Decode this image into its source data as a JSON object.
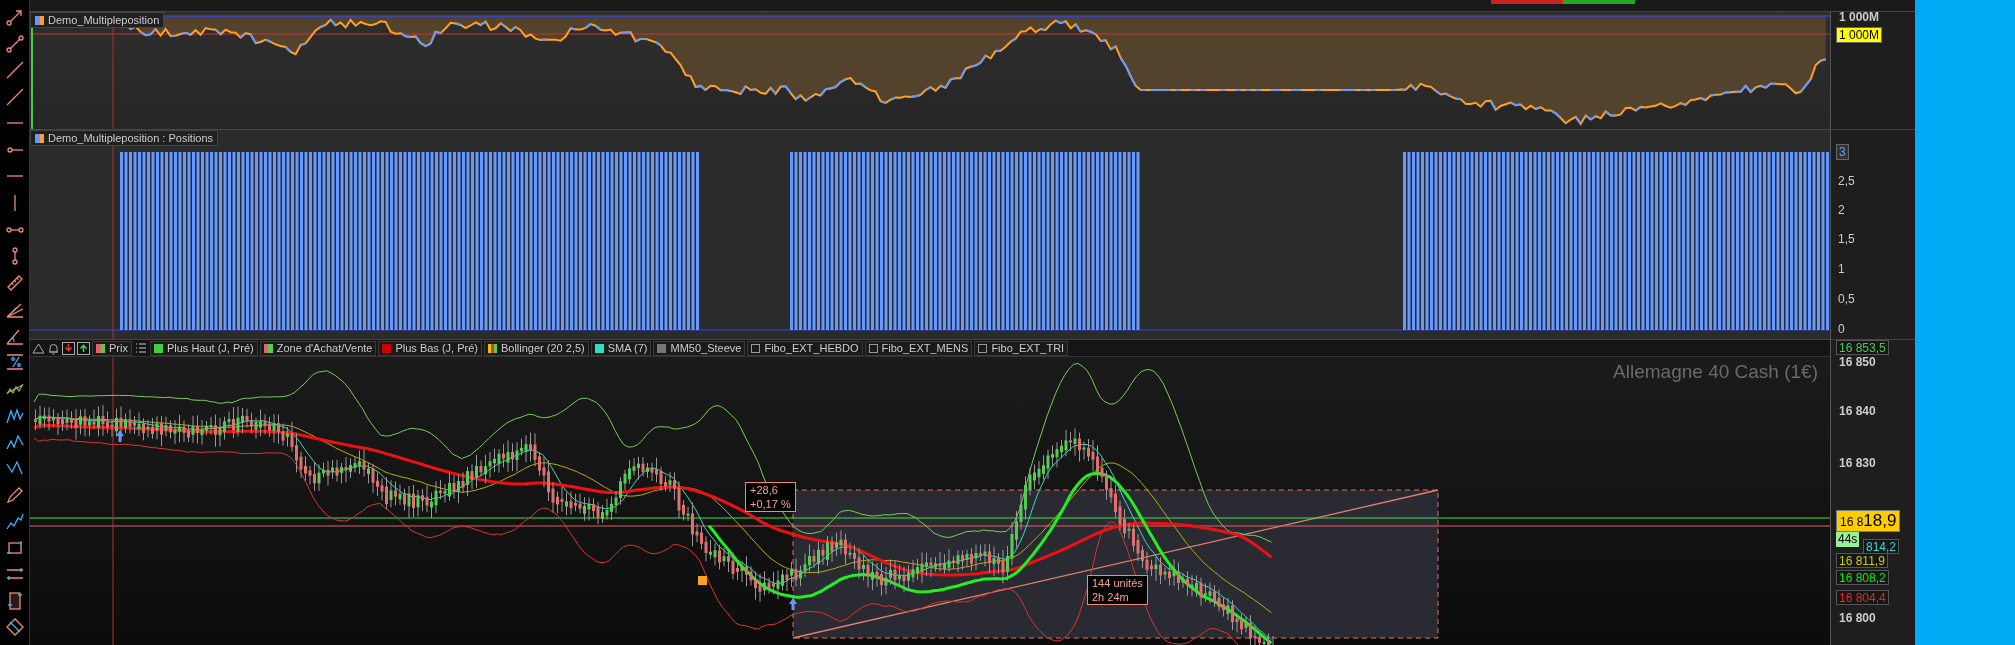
{
  "equity_panel": {
    "title": "Demo_Multipleposition",
    "axis_labels": [
      "1 000M"
    ],
    "current_value": "1 000M"
  },
  "positions_panel": {
    "title": "Demo_Multipleposition : Positions",
    "current_value": "3",
    "axis_labels": [
      "2,5",
      "2",
      "1,5",
      "1",
      "0,5",
      "0"
    ]
  },
  "price_panel": {
    "instrument": "Allemagne 40 Cash (1€)",
    "legend": [
      {
        "kind": "swatch",
        "label": "Prix",
        "swatch": [
          {
            "color": "#e06666"
          },
          {
            "color": "#55cc55"
          }
        ]
      },
      {
        "kind": "list-button"
      },
      {
        "kind": "swatch",
        "label": "Plus Haut (J, Pré)",
        "swatch": [
          {
            "color": "#44cc44"
          }
        ]
      },
      {
        "kind": "swatch",
        "label": "Zone d'Achat/Vente",
        "swatch": [
          {
            "color": "#e06666"
          },
          {
            "color": "#55cc55"
          }
        ]
      },
      {
        "kind": "swatch",
        "label": "Plus Bas (J, Pré)",
        "swatch": [
          {
            "color": "#cc0000"
          }
        ]
      },
      {
        "kind": "swatch",
        "label": "Bollinger (20 2,5)",
        "swatch": [
          {
            "color": "#e0c000"
          },
          {
            "color": "#dd3333"
          },
          {
            "color": "#55cc55"
          }
        ]
      },
      {
        "kind": "swatch",
        "label": "SMA (7)",
        "swatch": [
          {
            "color": "#33ddbb"
          }
        ]
      },
      {
        "kind": "swatch",
        "label": "MM50_Steeve",
        "swatch": [
          {
            "color": "#777777"
          }
        ]
      },
      {
        "kind": "checkbox",
        "label": "Fibo_EXT_HEBDO",
        "checked": false
      },
      {
        "kind": "checkbox",
        "label": "Fibo_EXT_MENS",
        "checked": false
      },
      {
        "kind": "checkbox",
        "label": "Fibo_EXT_TRI",
        "checked": false
      }
    ],
    "axis_labels": [
      "16 850",
      "16 840",
      "16 830",
      "16 800"
    ],
    "price_tags": [
      {
        "text": "16 853,5",
        "color": "#44cc44"
      },
      {
        "text": "814,2",
        "color": "#33ddcc"
      },
      {
        "text": "16 811,9",
        "color": "#cccc00"
      },
      {
        "text": "16 808,2",
        "color": "#00ee00"
      },
      {
        "text": "16 804,4",
        "color": "#ee2222"
      }
    ],
    "last_price": {
      "prefix": "16 8",
      "value": "18,9"
    },
    "countdown": "44s",
    "annotations": [
      {
        "lines": [
          "+28,6",
          "+0,17 %"
        ]
      },
      {
        "lines": [
          "144 unités",
          "2h 24m"
        ]
      }
    ]
  }
}
